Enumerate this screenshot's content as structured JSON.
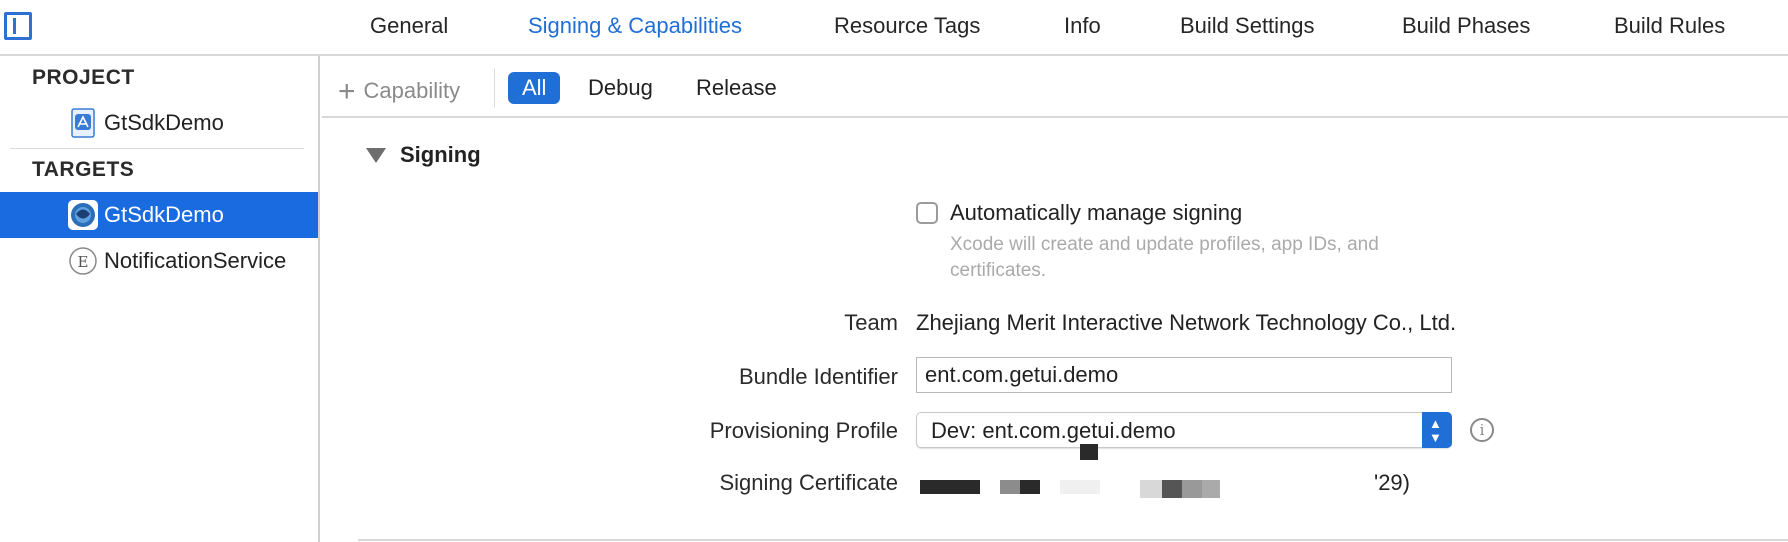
{
  "tabs": [
    {
      "label": "General"
    },
    {
      "label": "Signing & Capabilities",
      "active": true
    },
    {
      "label": "Resource Tags"
    },
    {
      "label": "Info"
    },
    {
      "label": "Build Settings"
    },
    {
      "label": "Build Phases"
    },
    {
      "label": "Build Rules"
    }
  ],
  "sidebar": {
    "project_header": "PROJECT",
    "project_item": {
      "label": "GtSdkDemo",
      "icon": "xcode-project-icon"
    },
    "targets_header": "TARGETS",
    "targets": [
      {
        "label": "GtSdkDemo",
        "icon": "app-icon",
        "selected": true
      },
      {
        "label": "NotificationService",
        "icon": "extension-icon"
      }
    ]
  },
  "filterbar": {
    "add_capability": "Capability",
    "filters": [
      "All",
      "Debug",
      "Release"
    ],
    "active_filter": "All"
  },
  "signing": {
    "section_title": "Signing",
    "auto_manage_label": "Automatically manage signing",
    "auto_manage_checked": false,
    "auto_manage_desc": "Xcode will create and update profiles, app IDs, and certificates.",
    "team_label": "Team",
    "team_value": "Zhejiang Merit Interactive Network Technology Co., Ltd.",
    "bundle_label": "Bundle Identifier",
    "bundle_value": "ent.com.getui.demo",
    "profile_label": "Provisioning Profile",
    "profile_value": "Dev: ent.com.getui.demo",
    "certificate_label": "Signing Certificate",
    "certificate_value_visible": "'29)"
  },
  "colors": {
    "accent": "#1f6fd6",
    "selection": "#1a6ae0",
    "muted_text": "#aaaaaa"
  }
}
